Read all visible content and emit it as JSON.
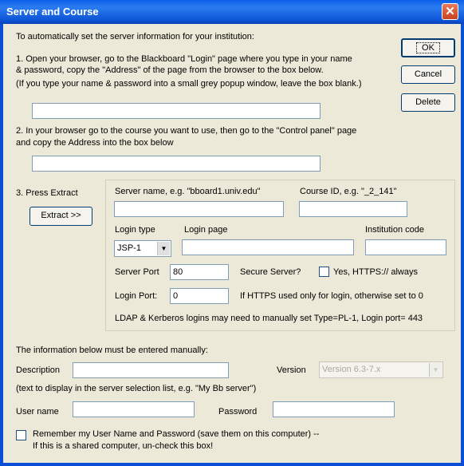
{
  "window": {
    "title": "Server and Course",
    "close_symbol": "✕"
  },
  "intro": "To automatically set the server information for your institution:",
  "step1": {
    "line1": "1.  Open your browser, go to the Blackboard \"Login\" page where you type in your name",
    "line2": "& password, copy the \"Address\" of the page from the browser to the box below.",
    "line3": "(If you type your name & password into a small grey popup window, leave the box blank.)",
    "value": ""
  },
  "step2": {
    "line1": "2.  In your browser go to the course you want to use, then go to the \"Control panel\" page",
    "line2": "and copy the Address into the box below",
    "value": ""
  },
  "step3": {
    "label": "3.  Press Extract",
    "extract_button": "Extract >>"
  },
  "buttons": {
    "ok": "OK",
    "cancel": "Cancel",
    "delete": "Delete"
  },
  "extract_group": {
    "server_name_label": "Server name, e.g. \"bboard1.univ.edu\"",
    "server_name_value": "",
    "course_id_label": "Course ID, e.g. \"_2_141\"",
    "course_id_value": "",
    "login_type_label": "Login type",
    "login_type_value": "JSP-1",
    "login_page_label": "Login page",
    "login_page_value": "",
    "institution_code_label": "Institution code",
    "institution_code_value": "",
    "server_port_label": "Server Port",
    "server_port_value": "80",
    "secure_server_label": "Secure Server?",
    "secure_server_checkbox_label": "Yes, HTTPS:// always",
    "login_port_label": "Login Port:",
    "login_port_value": "0",
    "login_port_note": "If HTTPS used only for login, otherwise set to 0",
    "ldap_note": "LDAP & Kerberos logins may need to manually set Type=PL-1, Login port= 443"
  },
  "manual": {
    "heading": "The information below must be entered manually:",
    "description_label": "Description",
    "description_value": "",
    "version_label": "Version",
    "version_value": "Version 6.3-7.x",
    "description_hint": "(text to display in the server selection list, e.g. \"My Bb server\")",
    "username_label": "User name",
    "username_value": "",
    "password_label": "Password",
    "password_value": "",
    "remember_line1": "Remember my User Name and Password (save them on this computer) --",
    "remember_line2": "If this is a shared computer, un-check this box!"
  }
}
